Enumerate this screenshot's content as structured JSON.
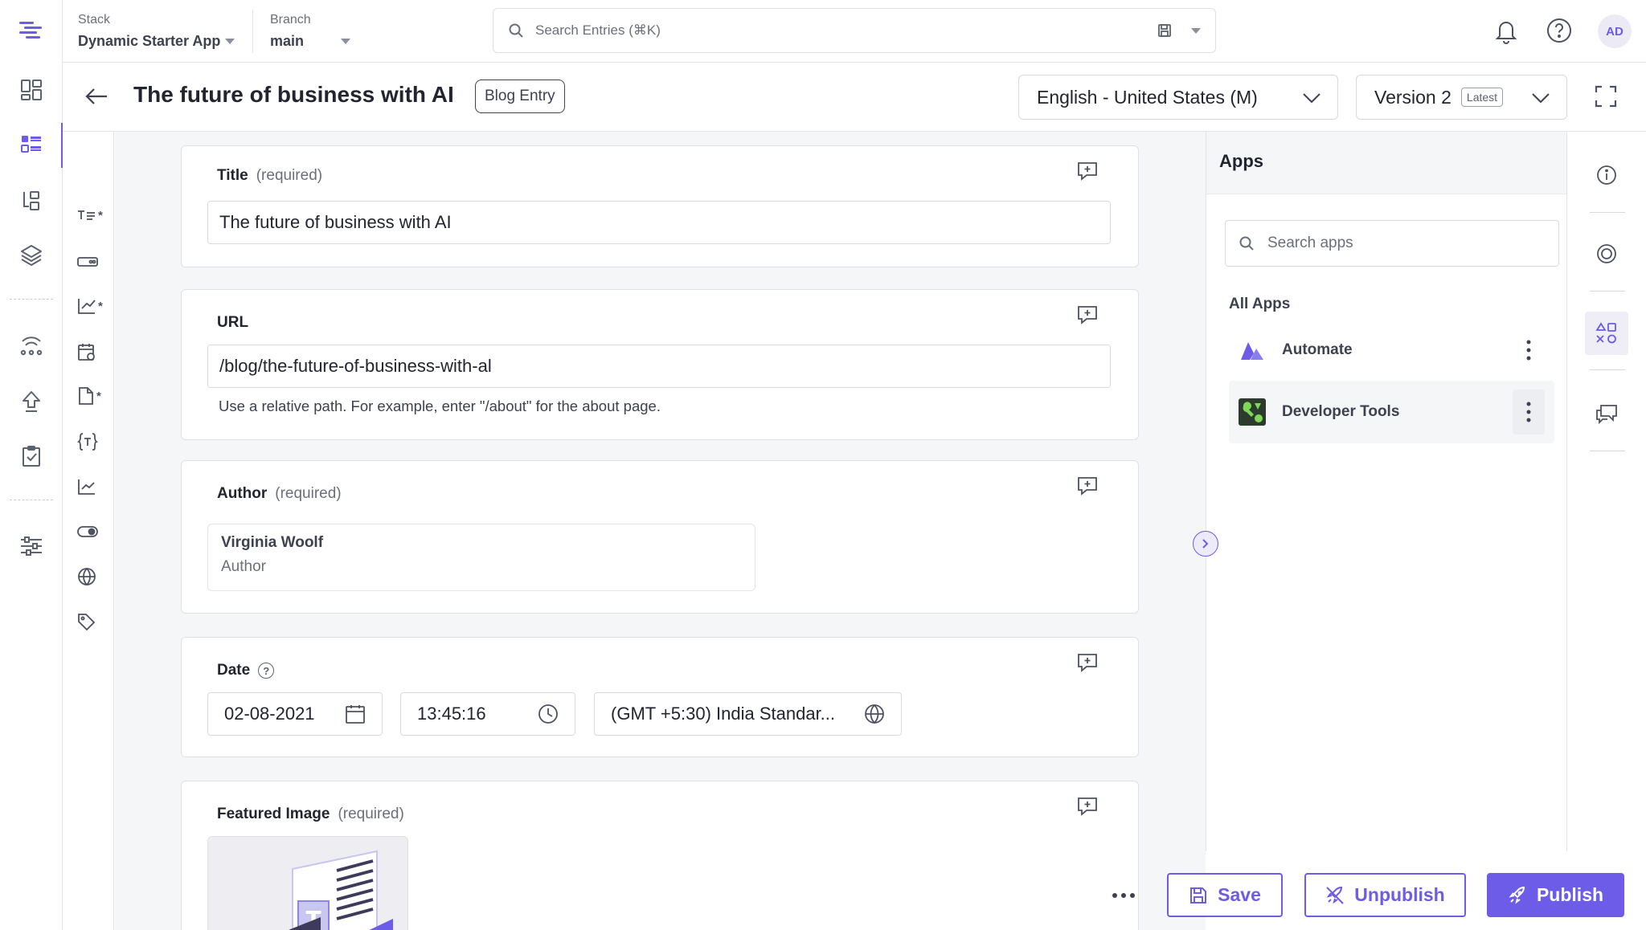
{
  "header": {
    "stack_label": "Stack",
    "stack_name": "Dynamic Starter App",
    "branch_label": "Branch",
    "branch_name": "main",
    "search_placeholder": "Search Entries (⌘K)",
    "avatar_initials": "AD"
  },
  "entry": {
    "title": "The future of business with AI",
    "content_type": "Blog Entry",
    "locale": "English - United States (M)",
    "version": "Version 2",
    "version_badge": "Latest"
  },
  "fields": {
    "title": {
      "label": "Title",
      "required": "(required)",
      "value": "The future of business with AI"
    },
    "url": {
      "label": "URL",
      "value": "/blog/the-future-of-business-with-al",
      "help": "Use a relative path. For example, enter \"/about\" for the about page."
    },
    "author": {
      "label": "Author",
      "required": "(required)",
      "ref_name": "Virginia Woolf",
      "ref_type": "Author"
    },
    "date": {
      "label": "Date",
      "date": "02-08-2021",
      "time": "13:45:16",
      "timezone": "(GMT +5:30) India Standar..."
    },
    "featured_image": {
      "label": "Featured Image",
      "required": "(required)"
    }
  },
  "apps_panel": {
    "title": "Apps",
    "search_placeholder": "Search apps",
    "section_label": "All Apps",
    "apps": [
      {
        "name": "Automate",
        "icon": "automate-logo"
      },
      {
        "name": "Developer Tools",
        "icon": "developer-tools-logo"
      }
    ]
  },
  "actions": {
    "save": "Save",
    "unpublish": "Unpublish",
    "publish": "Publish"
  },
  "colors": {
    "accent": "#6c5ce7",
    "border": "#dfe1e6",
    "editor_bg": "#f5f6f8"
  }
}
